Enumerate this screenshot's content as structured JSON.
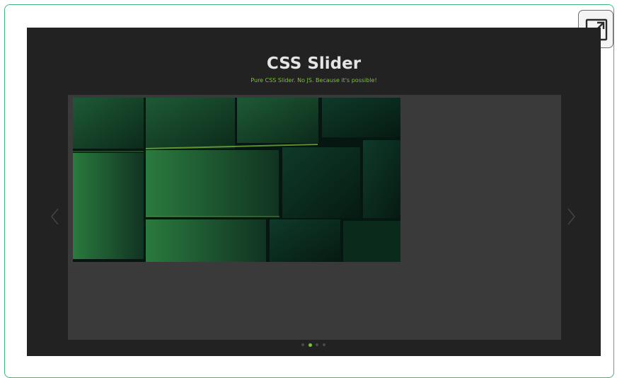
{
  "slider": {
    "title": "CSS Slider",
    "subtitle": "Pure CSS Slider. No JS. Because it's possible!",
    "active_slide": 2,
    "slide_count": 4,
    "prev_icon": "chevron-left-icon",
    "next_icon": "chevron-right-icon"
  },
  "toolbar": {
    "fullscreen_icon": "expand-icon"
  },
  "colors": {
    "accent": "#7cc23a",
    "frame_border": "#3fb877",
    "stage_bg": "#222222",
    "viewport_bg": "#3a3a3a"
  }
}
